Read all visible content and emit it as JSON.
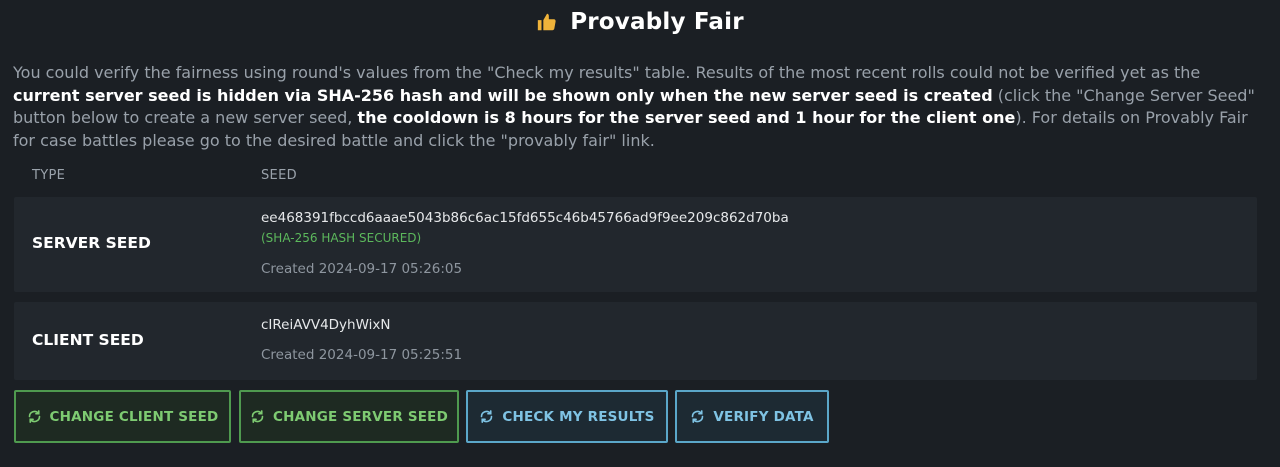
{
  "header": {
    "title": "Provably Fair",
    "icon": "thumbs-up-icon"
  },
  "intro": {
    "part1": "You could verify the fairness using round's values from the \"Check my results\" table. Results of the most recent rolls could not be verified yet as the ",
    "bold1": "current server seed is hidden via SHA-256 hash and will be shown only when the new server seed is created",
    "part2": " (click the \"Change Server Seed\" button below to create a new server seed, ",
    "bold2": "the cooldown is 8 hours for the server seed and 1 hour for the client one",
    "part3": "). For details on Provably Fair for case battles please go to the desired battle and click the \"provably fair\" link."
  },
  "table": {
    "col_type": "TYPE",
    "col_seed": "SEED",
    "server": {
      "type": "SERVER SEED",
      "value": "ee468391fbccd6aaae5043b86c6ac15fd655c46b45766ad9f9ee209c862d70ba",
      "secured": "(SHA-256 HASH SECURED)",
      "created": "Created 2024-09-17 05:26:05"
    },
    "client": {
      "type": "CLIENT SEED",
      "value": "cIReiAVV4DyhWixN",
      "created": "Created 2024-09-17 05:25:51"
    }
  },
  "buttons": {
    "change_client": "CHANGE CLIENT SEED",
    "change_server": "CHANGE SERVER SEED",
    "check_results": "CHECK MY RESULTS",
    "verify_data": "VERIFY DATA"
  },
  "colors": {
    "background": "#1b1f24",
    "row_background": "#22272d",
    "green_accent": "#7ecb72",
    "blue_accent": "#7fc3e4",
    "icon_gold": "#f0b33a"
  }
}
